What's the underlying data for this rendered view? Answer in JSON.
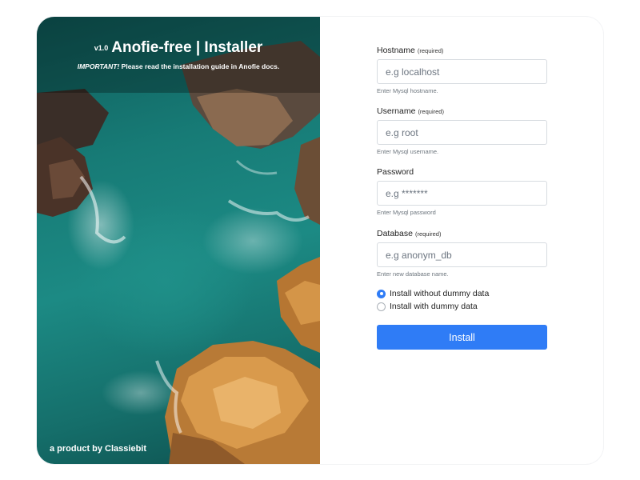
{
  "hero": {
    "version": "v1.0",
    "title": "Anofie-free | Installer",
    "notice_emphasis": "IMPORTANT!",
    "notice_text": "Please read the installation guide in Anofie docs.",
    "footer": "a product by Classiebit"
  },
  "form": {
    "fields": [
      {
        "label": "Hostname",
        "required": "(required)",
        "placeholder": "e.g localhost",
        "help": "Enter Mysql hostname."
      },
      {
        "label": "Username",
        "required": "(required)",
        "placeholder": "e.g root",
        "help": "Enter Mysql username."
      },
      {
        "label": "Password",
        "required": "",
        "placeholder": "e.g *******",
        "help": "Enter Mysql password"
      },
      {
        "label": "Database",
        "required": "(required)",
        "placeholder": "e.g anonym_db",
        "help": "Enter new database name."
      }
    ],
    "options": [
      {
        "label": "Install without dummy data",
        "checked": true
      },
      {
        "label": "Install with dummy data",
        "checked": false
      }
    ],
    "submit_label": "Install"
  },
  "colors": {
    "accent": "#2f7cf6",
    "sea": "#177b76",
    "rock": "#c9853a"
  }
}
